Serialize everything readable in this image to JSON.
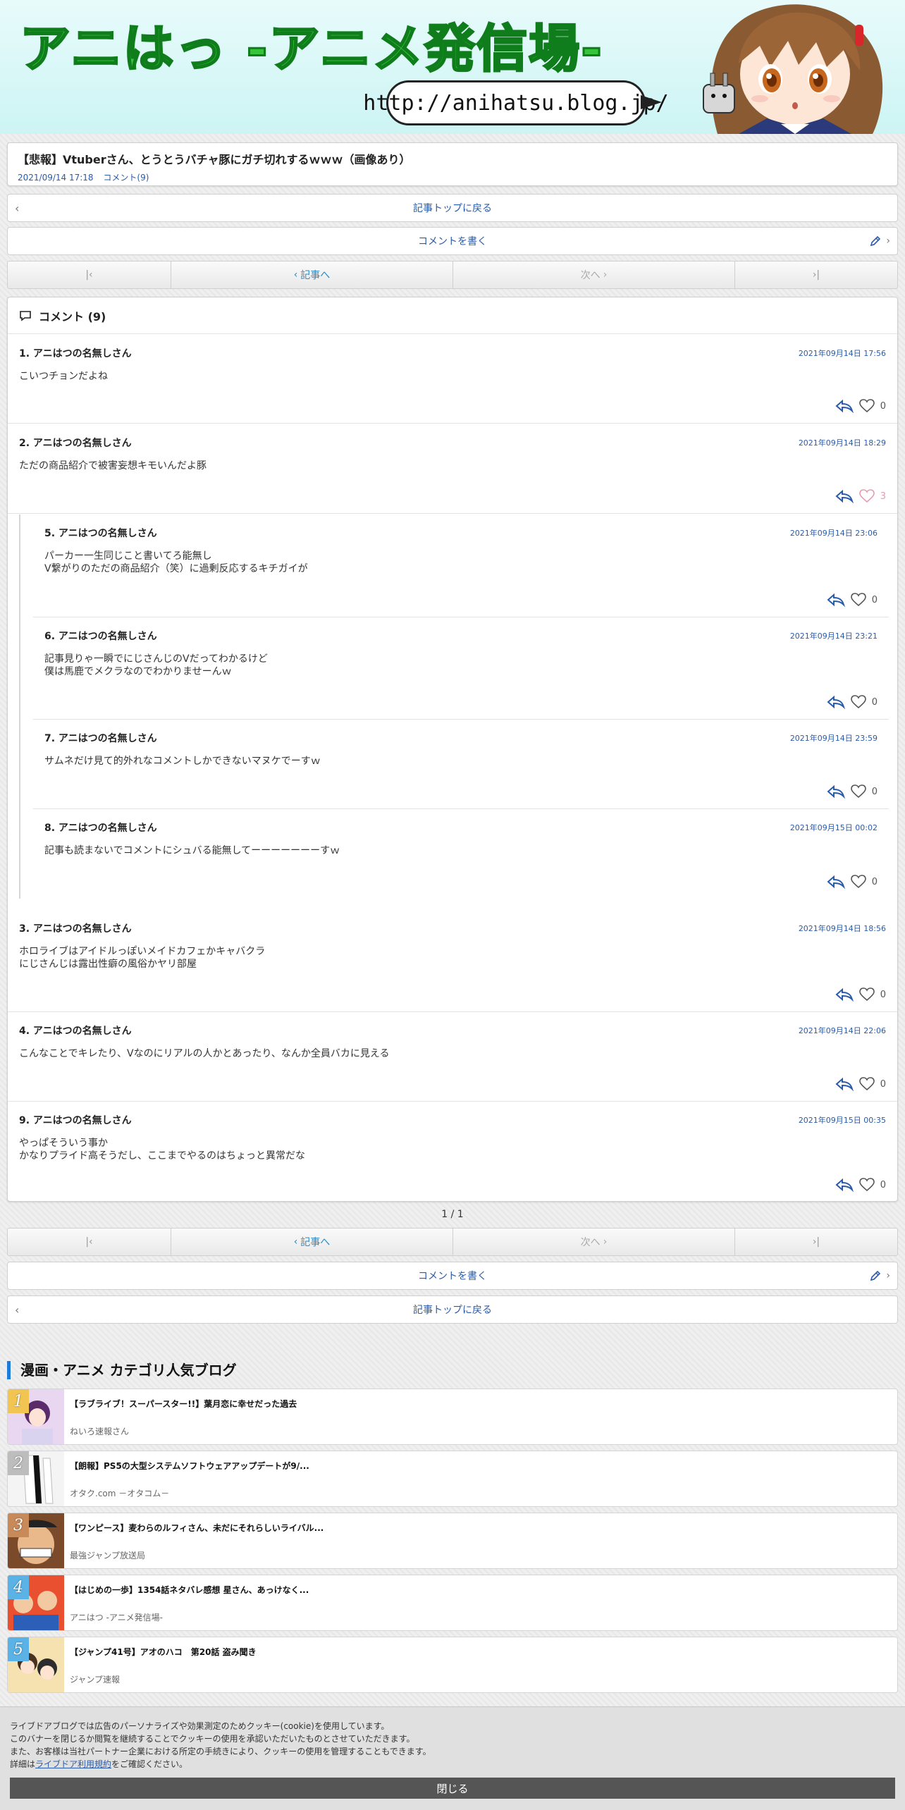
{
  "header": {
    "title": "アニはっ -アニメ発信場-",
    "url": "http://anihatsu.blog.jp/"
  },
  "article": {
    "title": "【悲報】Vtuberさん、とうとうバチャ豚にガチ切れするｗｗｗ（画像あり）",
    "date": "2021/09/14 17:18",
    "comment_link": "コメント(9)"
  },
  "nav": {
    "back_to_top": "記事トップに戻る",
    "write_comment": "コメントを書く",
    "prev_label": "記事へ",
    "next_label": "次へ"
  },
  "comments": {
    "header": "コメント (9)",
    "items": [
      {
        "name": "1.  アニはつの名無しさん",
        "date": "2021年09月14日 17:56",
        "body": "こいつチョンだよね",
        "likes": "0"
      },
      {
        "name": "2.  アニはつの名無しさん",
        "date": "2021年09月14日 18:29",
        "body": "ただの商品紹介で被害妄想キモいんだよ豚",
        "likes": "3"
      },
      {
        "name": "5.  アニはつの名無しさん",
        "date": "2021年09月14日 23:06",
        "body": "パーカー一生同じこと書いてろ能無し\nV繋がりのただの商品紹介（笑）に過剰反応するキチガイが",
        "likes": "0"
      },
      {
        "name": "6.  アニはつの名無しさん",
        "date": "2021年09月14日 23:21",
        "body": "記事見りゃ一瞬でにじさんじのVだってわかるけど\n僕は馬鹿でメクラなのでわかりませーんｗ",
        "likes": "0"
      },
      {
        "name": "7.  アニはつの名無しさん",
        "date": "2021年09月14日 23:59",
        "body": "サムネだけ見て的外れなコメントしかできないマヌケでーすｗ",
        "likes": "0"
      },
      {
        "name": "8.  アニはつの名無しさん",
        "date": "2021年09月15日 00:02",
        "body": "記事も読まないでコメントにシュバる能無してーーーーーーーすｗ",
        "likes": "0"
      },
      {
        "name": "3.  アニはつの名無しさん",
        "date": "2021年09月14日 18:56",
        "body": "ホロライブはアイドルっぽいメイドカフェかキャバクラ\nにじさんじは露出性癖の風俗かヤリ部屋",
        "likes": "0"
      },
      {
        "name": "4.  アニはつの名無しさん",
        "date": "2021年09月14日 22:06",
        "body": "こんなことでキレたり、Vなのにリアルの人かとあったり、なんか全員バカに見える",
        "likes": "0"
      },
      {
        "name": "9.  アニはつの名無しさん",
        "date": "2021年09月15日 00:35",
        "body": "やっぱそういう事か\nかなりプライド高そうだし、ここまでやるのはちょっと異常だな",
        "likes": "0"
      }
    ]
  },
  "pagination": {
    "indicator": "1 / 1"
  },
  "popular": {
    "heading": "漫画・アニメ カテゴリ人気ブログ",
    "items": [
      {
        "rank": "1",
        "title": "【ラブライブ！スーパースター!!】葉月恋に幸せだった過去",
        "source": "ねいろ速報さん"
      },
      {
        "rank": "2",
        "title": "【朗報】PS5の大型システムソフトウェアアップデートが9/...",
        "source": "オタク.com －オタコム－"
      },
      {
        "rank": "3",
        "title": "【ワンピース】麦わらのルフィさん、未だにそれらしいライバル...",
        "source": "最強ジャンプ放送局"
      },
      {
        "rank": "4",
        "title": "【はじめの一歩】1354話ネタバレ感想 星さん、あっけなく...",
        "source": "アニはつ -アニメ発信場-"
      },
      {
        "rank": "5",
        "title": "【ジャンプ41号】アオのハコ　第20話 盗み聞き",
        "source": "ジャンプ速報"
      }
    ]
  },
  "cookie": {
    "line1": "ライブドアブログでは広告のパーソナライズや効果測定のためクッキー(cookie)を使用しています。",
    "line2": "このバナーを閉じるか閲覧を継続することでクッキーの使用を承認いただいたものとさせていただきます。",
    "line3": "また、お客様は当社パートナー企業における所定の手続きにより、クッキーの使用を管理することもできます。",
    "line4_prefix": "詳細は",
    "line4_link": "ライブドア利用規約",
    "line4_suffix": "をご確認ください。",
    "close": "閉じる"
  },
  "colors": {
    "link": "#2a5ba8",
    "accent_blue": "#1f7ad8",
    "header_green": "#36c43a",
    "liked_pink": "#e89aae"
  }
}
